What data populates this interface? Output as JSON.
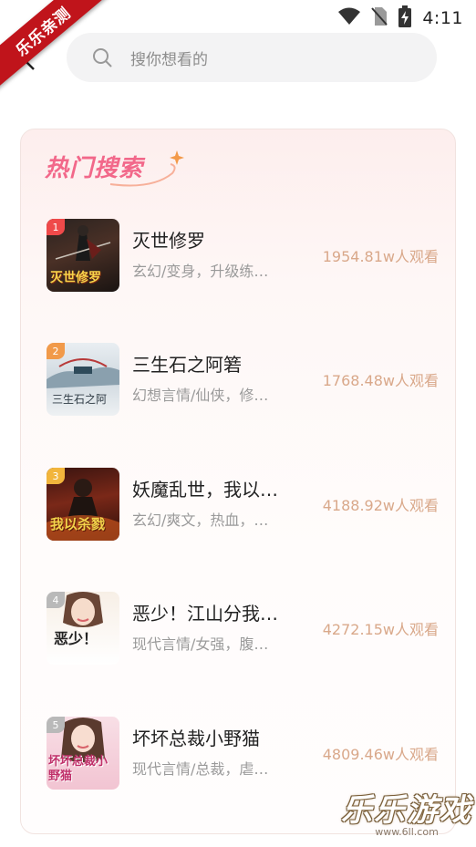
{
  "status_bar": {
    "time": "4:11",
    "icons": [
      "wifi-icon",
      "no-sim-icon",
      "battery-charging-icon"
    ]
  },
  "ribbon": {
    "text": "乐乐亲测"
  },
  "search": {
    "placeholder": "搜你想看的",
    "icon": "search-icon"
  },
  "hot_section": {
    "title": "热门搜索",
    "items": [
      {
        "rank": "1",
        "title": "灭世修罗",
        "tags": "玄幻/变身，升级练…",
        "views": "1954.81w人观看",
        "cover_text": "灭世修罗",
        "badge_color": "#ef4a4a"
      },
      {
        "rank": "2",
        "title": "三生石之阿箬",
        "tags": "幻想言情/仙侠，修…",
        "views": "1768.48w人观看",
        "cover_text": "三生石之阿",
        "badge_color": "#f19a4a"
      },
      {
        "rank": "3",
        "title": "妖魔乱世，我以…",
        "tags": "玄幻/爽文，热血，…",
        "views": "4188.92w人观看",
        "cover_text": "我以杀戮",
        "badge_color": "#f2b53c"
      },
      {
        "rank": "4",
        "title": "恶少！江山分我…",
        "tags": "现代言情/女强，腹…",
        "views": "4272.15w人观看",
        "cover_text": "恶少！",
        "badge_color": "#b9b9b9"
      },
      {
        "rank": "5",
        "title": "坏坏总裁小野猫",
        "tags": "现代言情/总裁，虐…",
        "views": "4809.46w人观看",
        "cover_text": "坏坏总裁小野猫",
        "badge_color": "#b9b9b9"
      }
    ]
  },
  "watermark": {
    "main": "乐乐游戏",
    "sub": "www.6ll.com"
  },
  "colors": {
    "accent_pink": "#f2688a",
    "views_color": "#d9a88a",
    "ribbon_red": "#c0141b"
  }
}
